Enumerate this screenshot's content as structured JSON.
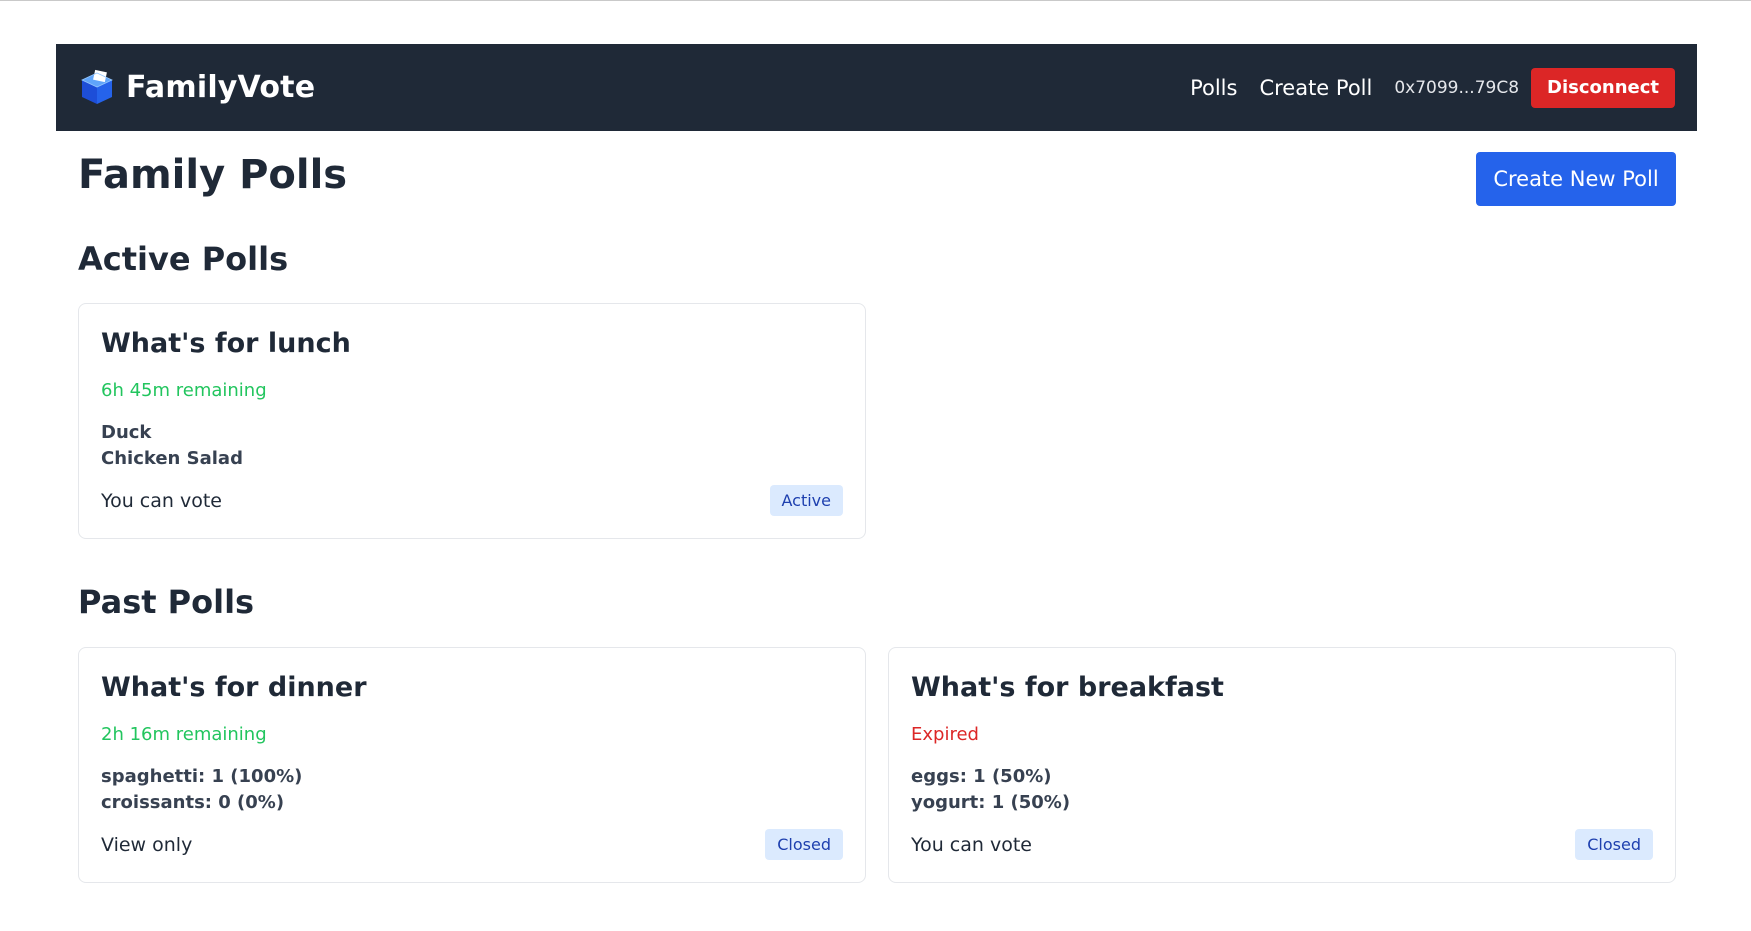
{
  "app": {
    "name": "FamilyVote",
    "brand_icon": "ballot-box-icon"
  },
  "nav": {
    "links": [
      "Polls",
      "Create Poll"
    ],
    "wallet": "0x7099...79C8",
    "disconnect_label": "Disconnect"
  },
  "page": {
    "title": "Family Polls",
    "create_button": "Create New Poll"
  },
  "sections": {
    "active_title": "Active Polls",
    "past_title": "Past Polls"
  },
  "active_polls": [
    {
      "title": "What's for lunch",
      "status": "6h 45m remaining",
      "options": [
        "Duck",
        "Chicken Salad"
      ],
      "vote_text": "You can vote",
      "badge": "Active"
    }
  ],
  "past_polls": [
    {
      "title": "What's for dinner",
      "status": "2h 16m remaining",
      "options": [
        "spaghetti: 1 (100%)",
        "croissants: 0 (0%)"
      ],
      "vote_text": "View only",
      "badge": "Closed"
    },
    {
      "title": "What's for breakfast",
      "status": "Expired",
      "options": [
        "eggs: 1 (50%)",
        "yogurt: 1 (50%)"
      ],
      "vote_text": "You can vote",
      "badge": "Closed"
    }
  ],
  "colors": {
    "navbar": "#1f2937",
    "primary": "#2563eb",
    "danger": "#dc2626",
    "success": "#22c55e",
    "badge_bg": "#dbeafe",
    "badge_text": "#1e40af"
  }
}
